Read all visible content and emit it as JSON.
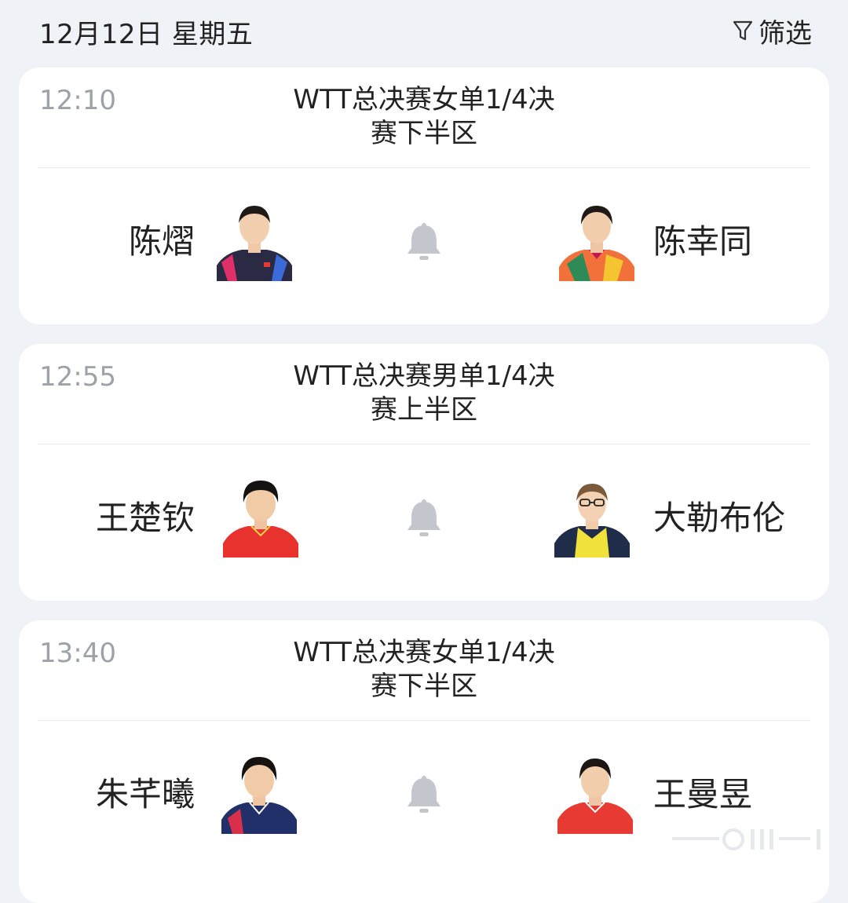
{
  "header": {
    "date_label": "12月12日 星期五",
    "filter_label": "筛选",
    "filter_icon": "funnel-icon"
  },
  "matches": [
    {
      "time": "12:10",
      "title_line1": "WTT总决赛女单1/4决",
      "title_line2": "赛下半区",
      "player_left": "陈熠",
      "player_right": "陈幸同",
      "left_jersey": "#2b2a45",
      "right_jersey": "#f2703a"
    },
    {
      "time": "12:55",
      "title_line1": "WTT总决赛男单1/4决",
      "title_line2": "赛上半区",
      "player_left": "王楚钦",
      "player_right": "大勒布伦",
      "left_jersey": "#e8322e",
      "right_jersey": "#1f2c4a"
    },
    {
      "time": "13:40",
      "title_line1": "WTT总决赛女单1/4决",
      "title_line2": "赛下半区",
      "player_left": "朱芊曦",
      "player_right": "王曼昱",
      "left_jersey": "#223069",
      "right_jersey": "#e63a33"
    }
  ],
  "colors": {
    "background": "#eff2f6",
    "card": "#ffffff",
    "time_text": "#9ea2a8",
    "bell": "#c3c7cd"
  }
}
